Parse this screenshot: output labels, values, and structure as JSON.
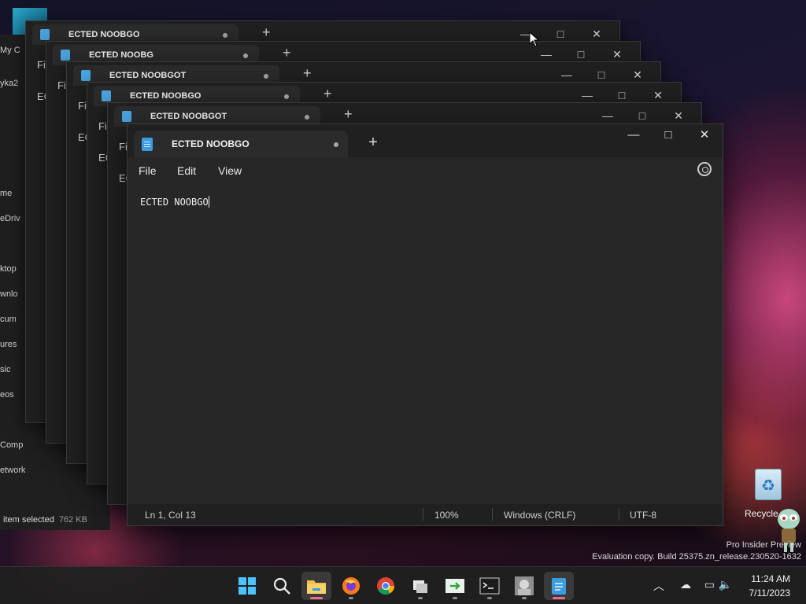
{
  "desktop": {
    "recycle_bin_label": "Recycle",
    "watermark_line1": "Pro Insider Preview",
    "watermark_line2": "Evaluation copy. Build 25375.zn_release.230520-1632"
  },
  "explorer_bg": {
    "items": [
      "My C",
      "yka2",
      "me",
      "eDriv",
      "ktop",
      "wnlo",
      "cum",
      "ures",
      "sic",
      "eos",
      "Comp",
      "etwork"
    ],
    "status_text": "item selected",
    "status_size": "762 KB"
  },
  "background_windows": [
    {
      "tab_title": "ECTED NOOBGO",
      "menu": "Fil",
      "menu2": "EC"
    },
    {
      "tab_title": "ECTED NOOBG",
      "menu": "Fil",
      "menu2": "EC"
    },
    {
      "tab_title": "ECTED NOOBGOT",
      "menu": "Fil",
      "menu2": "EC"
    },
    {
      "tab_title": "ECTED NOOBGO",
      "menu": "Fil",
      "menu2": "EC"
    },
    {
      "tab_title": "ECTED NOOBGOT",
      "menu": "Fil",
      "menu2": "EC"
    }
  ],
  "notepad": {
    "tab_title": "ECTED NOOBGO",
    "new_tab_glyph": "+",
    "controls": {
      "minimize": "—",
      "maximize": "□",
      "close": "✕"
    },
    "menu": {
      "file": "File",
      "edit": "Edit",
      "view": "View"
    },
    "content": "ECTED NOOBGO",
    "status": {
      "position": "Ln 1, Col 13",
      "zoom": "100%",
      "line_ending": "Windows (CRLF)",
      "encoding": "UTF-8"
    }
  },
  "taskbar": {
    "icons": [
      "windows-start-icon",
      "search-icon",
      "file-explorer-icon",
      "firefox-icon",
      "chrome-icon",
      "files-icon",
      "terminal-arrow-icon",
      "command-prompt-icon",
      "photo-icon",
      "notepad-icon"
    ],
    "clock_time": "11:24 AM",
    "clock_date": "7/11/2023"
  },
  "colors": {
    "accent_pink": "#f06b8f",
    "notepad_blue": "#3b9de0",
    "window_bg": "#272727"
  }
}
